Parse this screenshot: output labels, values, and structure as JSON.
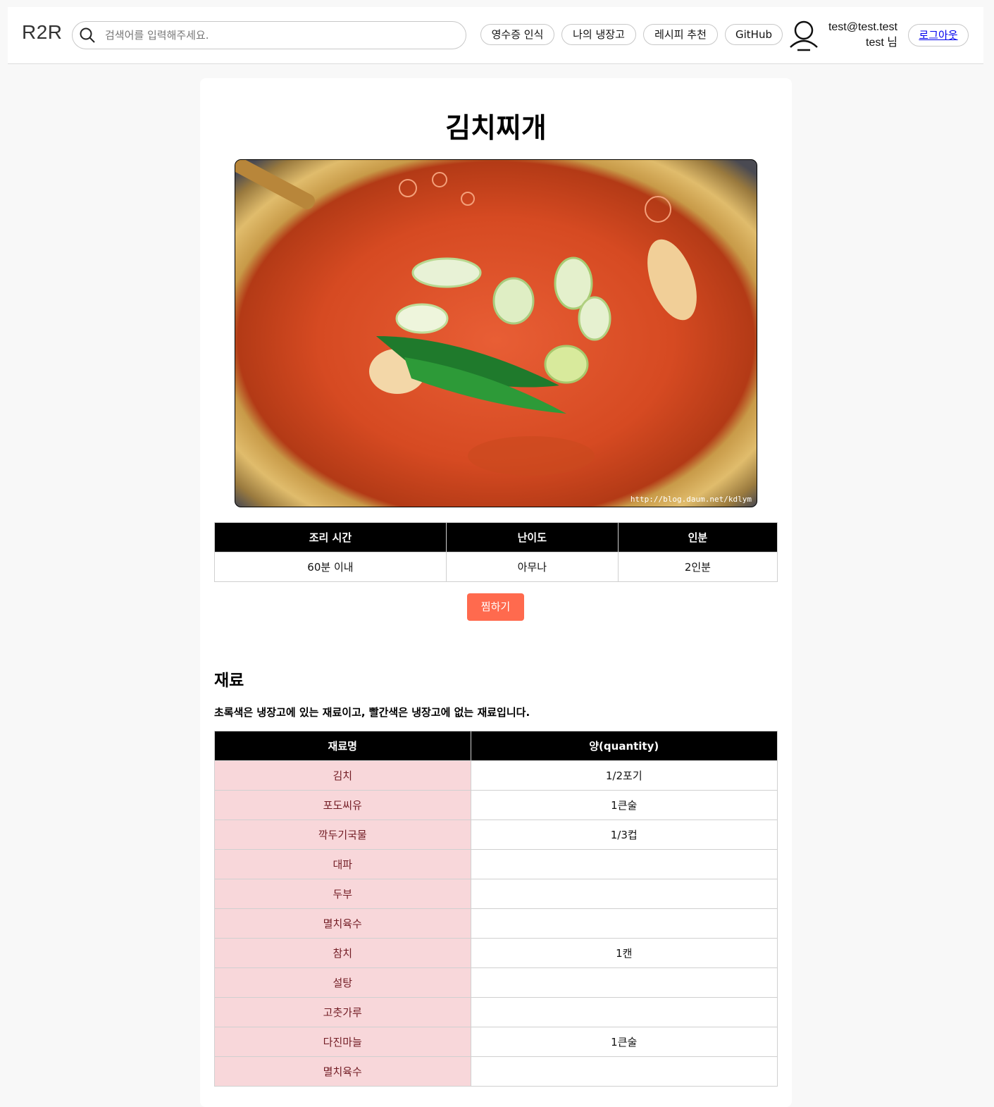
{
  "header": {
    "logo": "R2R",
    "search_placeholder": "검색어를 입력해주세요.",
    "nav": [
      "영수증 인식",
      "나의 냉장고",
      "레시피 추천",
      "GitHub"
    ],
    "user_email": "test@test.test",
    "user_name": "test 님",
    "logout_label": "로그아웃"
  },
  "recipe": {
    "title": "김치찌개",
    "image_caption": "http://blog.daum.net/kdlym",
    "info_headers": [
      "조리 시간",
      "난이도",
      "인분"
    ],
    "info_values": [
      "60분 이내",
      "아무나",
      "2인분"
    ],
    "zzim_label": "찜하기"
  },
  "ingredients": {
    "title": "재료",
    "note": "초록색은 냉장고에 있는 재료이고, 빨간색은 냉장고에 없는 재료입니다.",
    "headers": [
      "재료명",
      "양(quantity)"
    ],
    "rows": [
      {
        "name": "김치",
        "qty": "1/2포기"
      },
      {
        "name": "포도씨유",
        "qty": "1큰술"
      },
      {
        "name": "깍두기국물",
        "qty": "1/3컵"
      },
      {
        "name": "대파",
        "qty": ""
      },
      {
        "name": "두부",
        "qty": ""
      },
      {
        "name": "멸치육수",
        "qty": ""
      },
      {
        "name": "참치",
        "qty": "1캔"
      },
      {
        "name": "설탕",
        "qty": ""
      },
      {
        "name": "고춧가루",
        "qty": ""
      },
      {
        "name": "다진마늘",
        "qty": "1큰술"
      },
      {
        "name": "멸치육수",
        "qty": ""
      }
    ]
  },
  "colors": {
    "missing_bg": "#f8d7da",
    "missing_text": "#721c24",
    "zzim_button": "#ff6a4e",
    "table_header": "#000000"
  }
}
